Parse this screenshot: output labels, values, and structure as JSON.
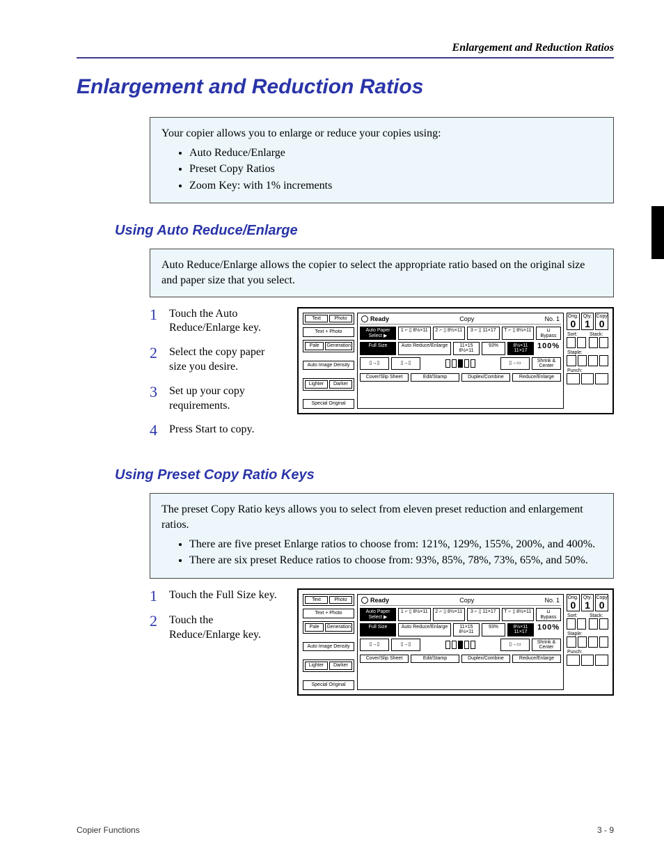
{
  "header": {
    "running_title": "Enlargement and Reduction Ratios"
  },
  "title": "Enlargement and Reduction Ratios",
  "intro": {
    "lead": "Your copier allows you to enlarge or reduce your copies using:",
    "bullets": [
      "Auto Reduce/Enlarge",
      "Preset Copy Ratios",
      "Zoom Key: with 1% increments"
    ]
  },
  "section_auto": {
    "heading": "Using Auto Reduce/Enlarge",
    "box": "Auto Reduce/Enlarge allows the copier to select the appropriate ratio based on the original size and paper size that you select.",
    "steps": [
      "Touch the Auto Reduce/Enlarge key.",
      "Select the copy paper size you desire.",
      "Set up your copy requirements.",
      "Press Start to copy."
    ]
  },
  "section_preset": {
    "heading": "Using Preset Copy Ratio Keys",
    "box_lead": "The preset Copy Ratio keys allows you to select from eleven preset reduction and enlargement ratios.",
    "box_bullets": [
      "There are five preset Enlarge ratios to choose from: 121%, 129%, 155%, 200%, and 400%.",
      "There are six preset Reduce ratios to choose from: 93%, 85%, 78%, 73%, 65%, and 50%."
    ],
    "steps": [
      "Touch the Full Size key.",
      "Touch the Reduce/Enlarge key."
    ]
  },
  "panel": {
    "ready": "Ready",
    "mode": "Copy",
    "job": "No. 1",
    "left_buttons": {
      "text": "Text",
      "photo": "Photo",
      "text_photo": "Text + Photo",
      "pale": "Pale",
      "generation": "Generation",
      "auto_density": "Auto Image Density",
      "lighter": "Lighter",
      "darker": "Darker",
      "special": "Special Original"
    },
    "center": {
      "auto_paper": "Auto Paper\nSelect ▶",
      "trays": [
        "1 ⌐ ▯\n8½×11",
        "2 ⌐ ▯\n8½×11",
        "3 ⌐ ▯\n11×17",
        "T ⌐ ▯\n8½×11",
        "⊔\nBypass"
      ],
      "full_size": "Full Size",
      "auto_re": "Auto Reduce/Enlarge",
      "ratio_a": "11×15\n8½×11",
      "ratio_pct": "93%",
      "ratio_b": "8½×11\n11×17",
      "hundred": "100%",
      "shrink": "Shrink &\nCenter",
      "tabs": [
        "Cover/Slip Sheet",
        "Edit/Stamp",
        "Duplex/Combine",
        "Reduce/Enlarge"
      ]
    },
    "right": {
      "orig": "Orig.",
      "qty": "Qty.",
      "copy": "Copy",
      "val0": "0",
      "val1": "1",
      "val0b": "0",
      "sort": "Sort:",
      "stack": "Stack:",
      "staple": "Staple:",
      "punch": "Punch:"
    }
  },
  "footer": {
    "left": "Copier Functions",
    "right": "3 - 9"
  }
}
